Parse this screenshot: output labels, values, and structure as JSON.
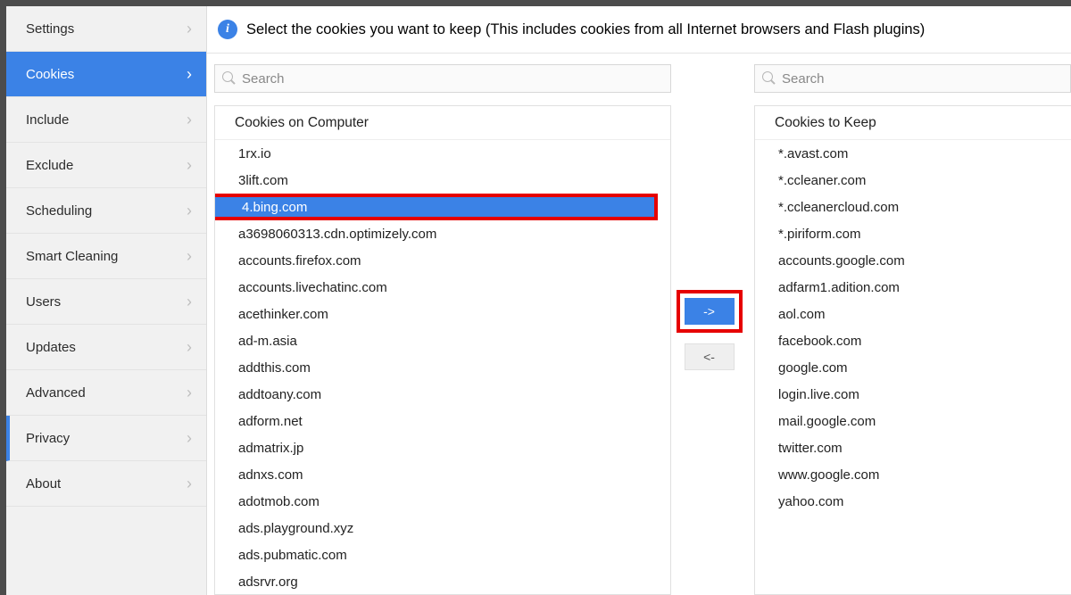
{
  "sidebar": {
    "items": [
      {
        "label": "Settings"
      },
      {
        "label": "Cookies"
      },
      {
        "label": "Include"
      },
      {
        "label": "Exclude"
      },
      {
        "label": "Scheduling"
      },
      {
        "label": "Smart Cleaning"
      },
      {
        "label": "Users"
      },
      {
        "label": "Updates"
      },
      {
        "label": "Advanced"
      },
      {
        "label": "Privacy"
      },
      {
        "label": "About"
      }
    ],
    "active_index": 1
  },
  "header": {
    "text": "Select the cookies you want to keep (This includes cookies from all Internet browsers and Flash plugins)"
  },
  "search": {
    "placeholder": "Search"
  },
  "left_panel": {
    "title": "Cookies on Computer",
    "items": [
      "1rx.io",
      "3lift.com",
      "4.bing.com",
      "a3698060313.cdn.optimizely.com",
      "accounts.firefox.com",
      "accounts.livechatinc.com",
      "acethinker.com",
      "ad-m.asia",
      "addthis.com",
      "addtoany.com",
      "adform.net",
      "admatrix.jp",
      "adnxs.com",
      "adotmob.com",
      "ads.playground.xyz",
      "ads.pubmatic.com",
      "adsrvr.org"
    ],
    "selected_index": 2
  },
  "right_panel": {
    "title": "Cookies to Keep",
    "items": [
      "*.avast.com",
      "*.ccleaner.com",
      "*.ccleanercloud.com",
      "*.piriform.com",
      "accounts.google.com",
      "adfarm1.adition.com",
      "aol.com",
      "facebook.com",
      "google.com",
      "login.live.com",
      "mail.google.com",
      "twitter.com",
      "www.google.com",
      "yahoo.com"
    ]
  },
  "buttons": {
    "move_right": "->",
    "move_left": "<-"
  }
}
